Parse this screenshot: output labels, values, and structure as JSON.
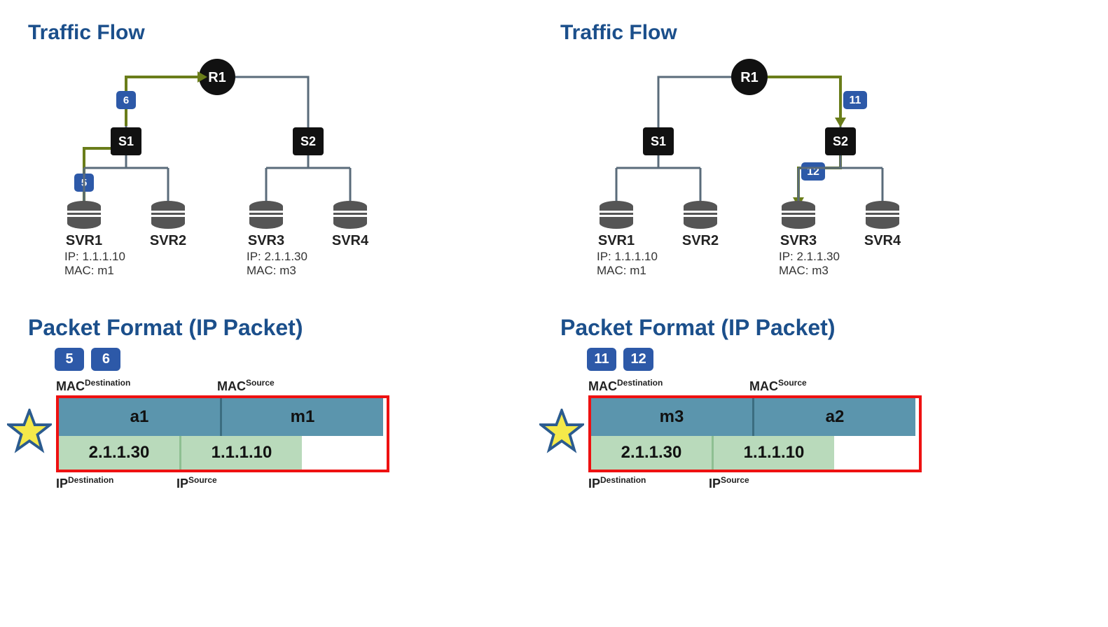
{
  "panels": [
    {
      "traffic_title": "Traffic Flow",
      "pf_title": "Packet Format (IP Packet)",
      "router": "R1",
      "switches": [
        "S1",
        "S2"
      ],
      "servers": [
        {
          "name": "SVR1",
          "ip": "IP: 1.1.1.10",
          "mac": "MAC: m1"
        },
        {
          "name": "SVR2"
        },
        {
          "name": "SVR3",
          "ip": "IP: 2.1.1.30",
          "mac": "MAC: m3"
        },
        {
          "name": "SVR4"
        }
      ],
      "hops": [
        "5",
        "6"
      ],
      "badges": [
        "5",
        "6"
      ],
      "mac_labels": {
        "dst": "MAC",
        "dst_sup": "Destination",
        "src": "MAC",
        "src_sup": "Source"
      },
      "ip_labels": {
        "dst": "IP",
        "dst_sup": "Destination",
        "src": "IP",
        "src_sup": "Source"
      },
      "mac": {
        "dst": "a1",
        "src": "m1"
      },
      "ip": {
        "dst": "2.1.1.30",
        "src": "1.1.1.10"
      }
    },
    {
      "traffic_title": "Traffic Flow",
      "pf_title": "Packet Format (IP Packet)",
      "router": "R1",
      "switches": [
        "S1",
        "S2"
      ],
      "servers": [
        {
          "name": "SVR1",
          "ip": "IP: 1.1.1.10",
          "mac": "MAC: m1"
        },
        {
          "name": "SVR2"
        },
        {
          "name": "SVR3",
          "ip": "IP: 2.1.1.30",
          "mac": "MAC: m3"
        },
        {
          "name": "SVR4"
        }
      ],
      "hops": [
        "11",
        "12"
      ],
      "badges": [
        "11",
        "12"
      ],
      "mac_labels": {
        "dst": "MAC",
        "dst_sup": "Destination",
        "src": "MAC",
        "src_sup": "Source"
      },
      "ip_labels": {
        "dst": "IP",
        "dst_sup": "Destination",
        "src": "IP",
        "src_sup": "Source"
      },
      "mac": {
        "dst": "m3",
        "src": "a2"
      },
      "ip": {
        "dst": "2.1.1.30",
        "src": "1.1.1.10"
      }
    }
  ]
}
